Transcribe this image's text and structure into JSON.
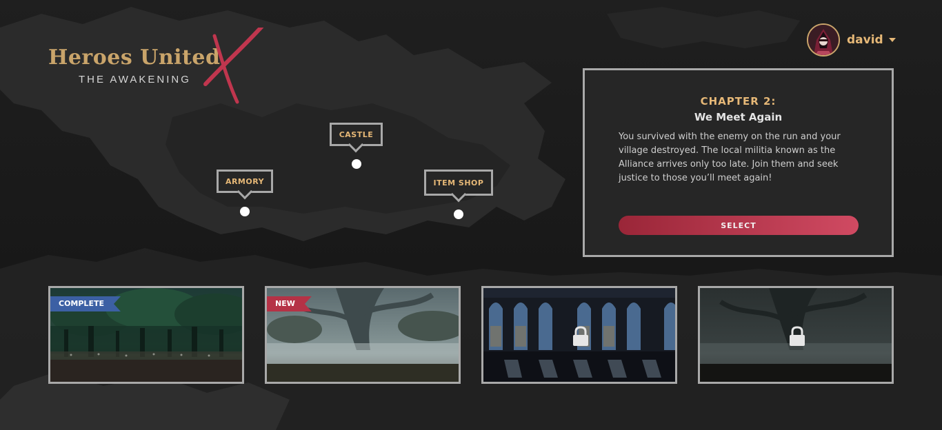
{
  "logo": {
    "title": "Heroes United",
    "subtitle": "THE AWAKENING",
    "accent_color": "#c0364e"
  },
  "user": {
    "name": "david",
    "avatar_icon": "hooded-hero-avatar",
    "dropdown_icon": "caret-down-icon"
  },
  "chapter": {
    "label": "CHAPTER 2:",
    "title": "We Meet Again",
    "description": "You survived with the enemy on the run and your village destroyed. The local militia known as the Alliance arrives only too late. Join them and seek justice to those you’ll meet again!",
    "button_label": "SELECT"
  },
  "map_markers": [
    {
      "label": "ARMORY"
    },
    {
      "label": "CASTLE"
    },
    {
      "label": "ITEM SHOP"
    }
  ],
  "levels": [
    {
      "badge": "COMPLETE",
      "badge_color": "#3c60a4",
      "scene": "dark forest",
      "locked": false
    },
    {
      "badge": "NEW",
      "badge_color": "#b53246",
      "scene": "misty forest",
      "locked": false
    },
    {
      "badge": "",
      "scene": "castle hall",
      "locked": true,
      "lock_icon": "lock-icon"
    },
    {
      "badge": "",
      "scene": "dark misty forest",
      "locked": true,
      "lock_icon": "lock-icon"
    }
  ],
  "colors": {
    "background": "#181818",
    "map_land": "#2a2a2a",
    "gold": "#e6b877",
    "border": "#a9a9a9"
  }
}
